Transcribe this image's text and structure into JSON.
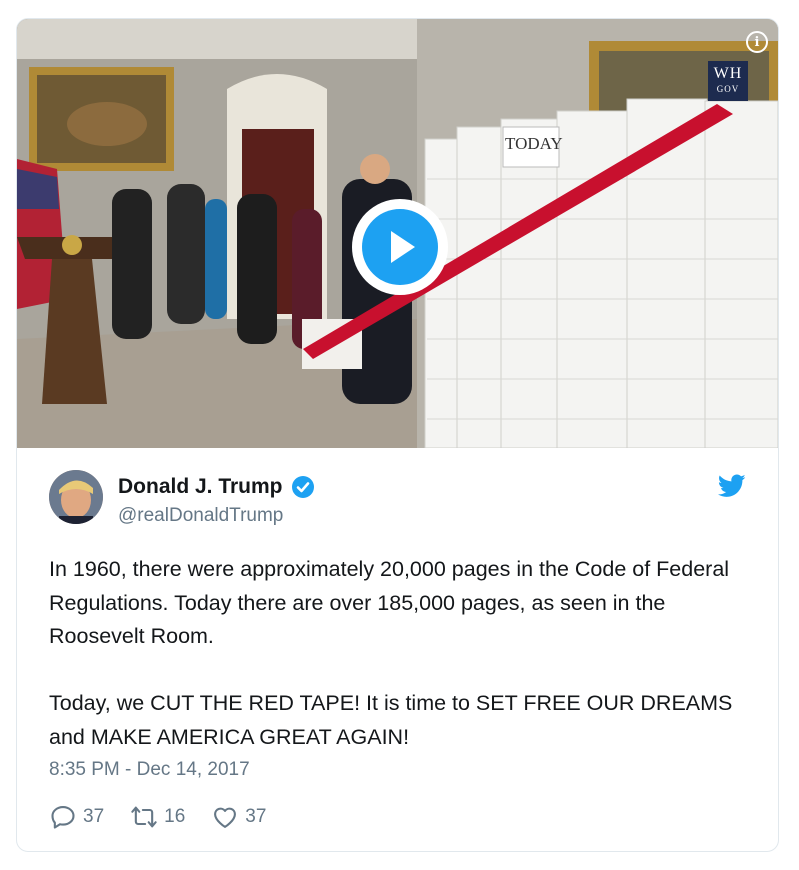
{
  "media": {
    "sign_text": "TODAY",
    "watermark": {
      "line1": "WH",
      "line2": "GOV"
    },
    "info_icon": "info-icon",
    "play_icon": "play-icon"
  },
  "author": {
    "display_name": "Donald J. Trump",
    "handle": "@realDonaldTrump",
    "verified": true,
    "avatar": "avatar"
  },
  "tweet": {
    "paragraphs": [
      "In 1960, there were approximately 20,000 pages in the Code of Federal Regulations. Today there are over 185,000 pages, as seen in the Roosevelt Room.",
      "Today, we CUT THE RED TAPE! It is time to SET FREE OUR DREAMS and MAKE AMERICA GREAT AGAIN!"
    ],
    "timestamp": "8:35 PM - Dec 14, 2017"
  },
  "actions": {
    "reply_count": "37",
    "retweet_count": "16",
    "like_count": "37"
  },
  "colors": {
    "twitter_blue": "#1da1f2",
    "secondary_text": "#657786",
    "primary_text": "#14171a",
    "border": "#e1e8ed",
    "red_tape": "#c8102e"
  },
  "icons": [
    "info-icon",
    "play-icon",
    "verified-icon",
    "twitter-bird-icon",
    "reply-icon",
    "retweet-icon",
    "like-icon"
  ]
}
